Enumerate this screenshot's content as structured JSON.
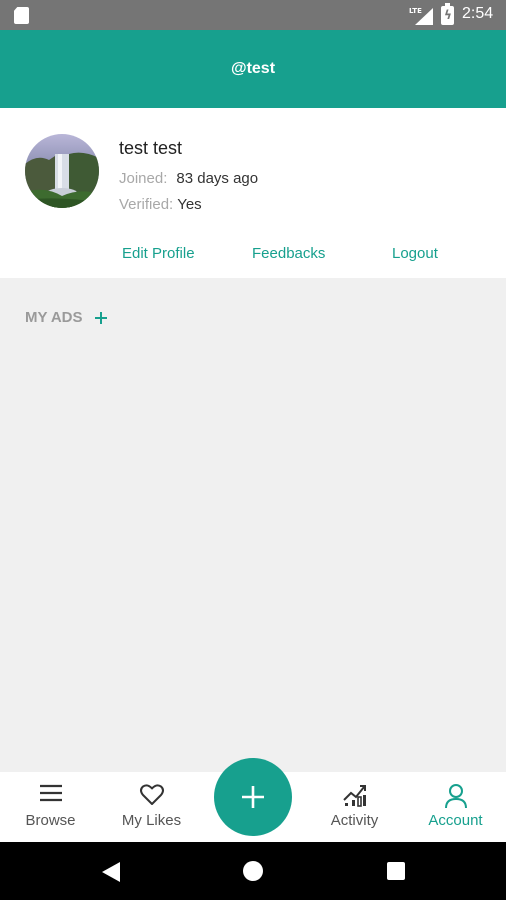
{
  "status_bar": {
    "network": "LTE",
    "time": "2:54"
  },
  "header": {
    "title": "@test"
  },
  "profile": {
    "name": "test test",
    "joined_label": "Joined:",
    "joined_value": "83 days ago",
    "verified_label": "Verified:",
    "verified_value": "Yes",
    "actions": {
      "edit": "Edit Profile",
      "feedbacks": "Feedbacks",
      "logout": "Logout"
    }
  },
  "my_ads": {
    "label": "MY ADS"
  },
  "bottom_nav": {
    "items": [
      {
        "label": "Browse",
        "icon": "menu-icon"
      },
      {
        "label": "My Likes",
        "icon": "heart-icon"
      },
      {
        "label": "Activity",
        "icon": "chart-icon"
      },
      {
        "label": "Account",
        "icon": "user-icon"
      }
    ],
    "active": "Account",
    "fab_icon": "plus-icon"
  },
  "colors": {
    "accent": "#17a08e",
    "background": "#f0f0f0",
    "status_bar": "#757575"
  }
}
